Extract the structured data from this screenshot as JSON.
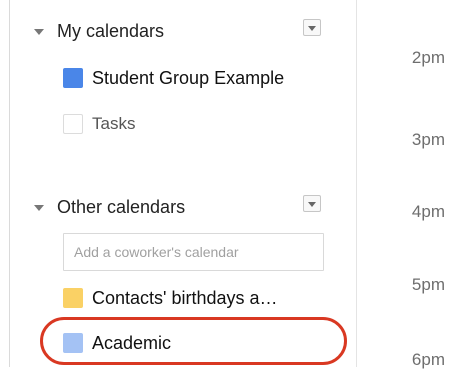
{
  "my_calendars": {
    "title": "My calendars",
    "items": [
      {
        "label": "Student Group Example",
        "color": "#4a86e8"
      },
      {
        "label": "Tasks",
        "color": "#ffffff"
      }
    ]
  },
  "other_calendars": {
    "title": "Other calendars",
    "coworker_placeholder": "Add a coworker's calendar",
    "items": [
      {
        "label": "Contacts' birthdays a…",
        "color": "#fad165"
      },
      {
        "label": "Academic",
        "color": "#a4c2f4"
      }
    ]
  },
  "time_labels": [
    "2pm",
    "3pm",
    "4pm",
    "5pm",
    "6pm"
  ],
  "highlight_color": "#d93822"
}
